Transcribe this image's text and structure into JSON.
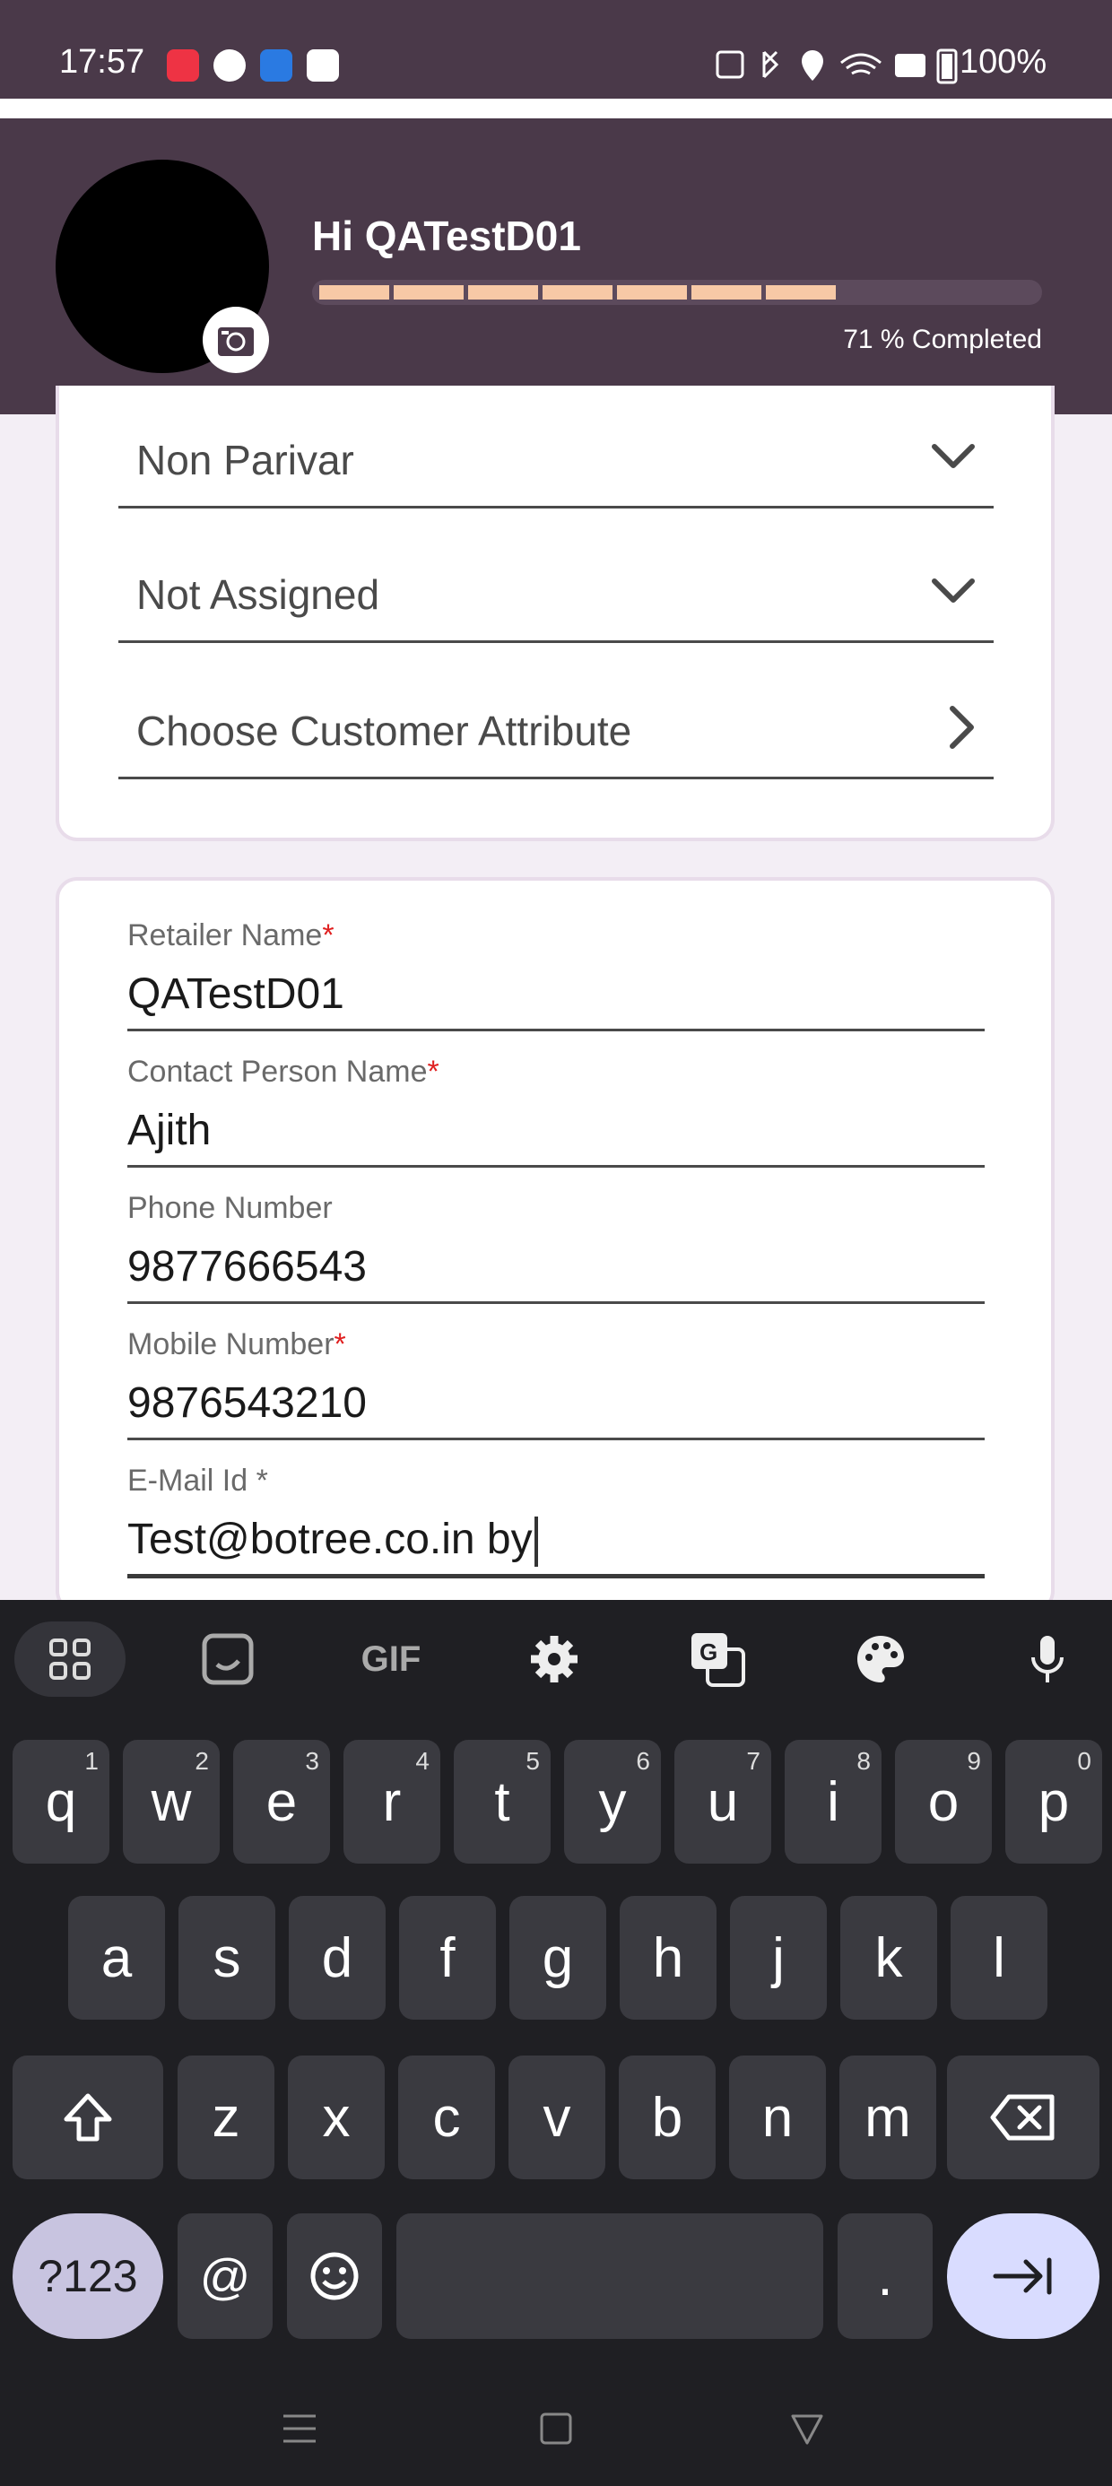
{
  "status_bar": {
    "time": "17:57",
    "battery": "100%"
  },
  "header": {
    "greeting": "Hi QATestD01",
    "progress_percent": 71,
    "progress_segments_filled": 7,
    "progress_text": "71 % Completed"
  },
  "dropdowns": [
    {
      "label": "Non Parivar",
      "icon": "chevron-down-icon"
    },
    {
      "label": "Not Assigned",
      "icon": "chevron-down-icon"
    },
    {
      "label": "Choose Customer Attribute",
      "icon": "chevron-right-icon"
    }
  ],
  "form": {
    "retailer_name": {
      "label": "Retailer Name",
      "required_mark": "*",
      "value": "QATestD01"
    },
    "contact_person": {
      "label": "Contact Person Name",
      "required_mark": "*",
      "value": "Ajith"
    },
    "phone": {
      "label": "Phone Number",
      "value": "9877666543"
    },
    "mobile": {
      "label": "Mobile Number",
      "required_mark": "*",
      "value": "9876543210"
    },
    "email": {
      "label": "E-Mail Id *",
      "value": "Test@botree.co.in by"
    }
  },
  "keyboard": {
    "toolbar": [
      "apps-grid-icon",
      "sticker-icon",
      "GIF",
      "gear-icon",
      "translate-icon",
      "palette-icon",
      "mic-icon"
    ],
    "row1": [
      "q",
      "w",
      "e",
      "r",
      "t",
      "y",
      "u",
      "i",
      "o",
      "p"
    ],
    "row1_hints": [
      "1",
      "2",
      "3",
      "4",
      "5",
      "6",
      "7",
      "8",
      "9",
      "0"
    ],
    "row2": [
      "a",
      "s",
      "d",
      "f",
      "g",
      "h",
      "j",
      "k",
      "l"
    ],
    "row3": [
      "z",
      "x",
      "c",
      "v",
      "b",
      "n",
      "m"
    ],
    "sym_key": "?123",
    "at_key": "@",
    "period_key": "."
  },
  "colors": {
    "header_bg": "#4a3949",
    "progress_fill": "#f7c9a6",
    "required": "#e02020"
  }
}
